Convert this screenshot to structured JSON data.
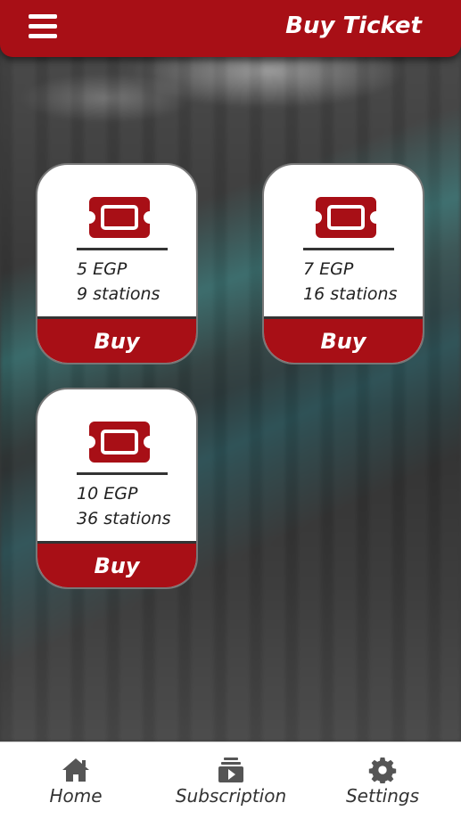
{
  "header": {
    "title": "Buy Ticket",
    "menu_icon": "hamburger-menu-icon"
  },
  "tickets": [
    {
      "price": "5 EGP",
      "stations": "9 stations",
      "buy_label": "Buy"
    },
    {
      "price": "7 EGP",
      "stations": "16 stations",
      "buy_label": "Buy"
    },
    {
      "price": "10 EGP",
      "stations": "36 stations",
      "buy_label": "Buy"
    }
  ],
  "bottom_nav": {
    "items": [
      {
        "label": "Home",
        "icon": "home-icon"
      },
      {
        "label": "Subscription",
        "icon": "subscription-icon"
      },
      {
        "label": "Settings",
        "icon": "gear-icon"
      }
    ]
  },
  "colors": {
    "primary": "#a80f16",
    "card_bg": "#ffffff",
    "text": "#222222"
  }
}
